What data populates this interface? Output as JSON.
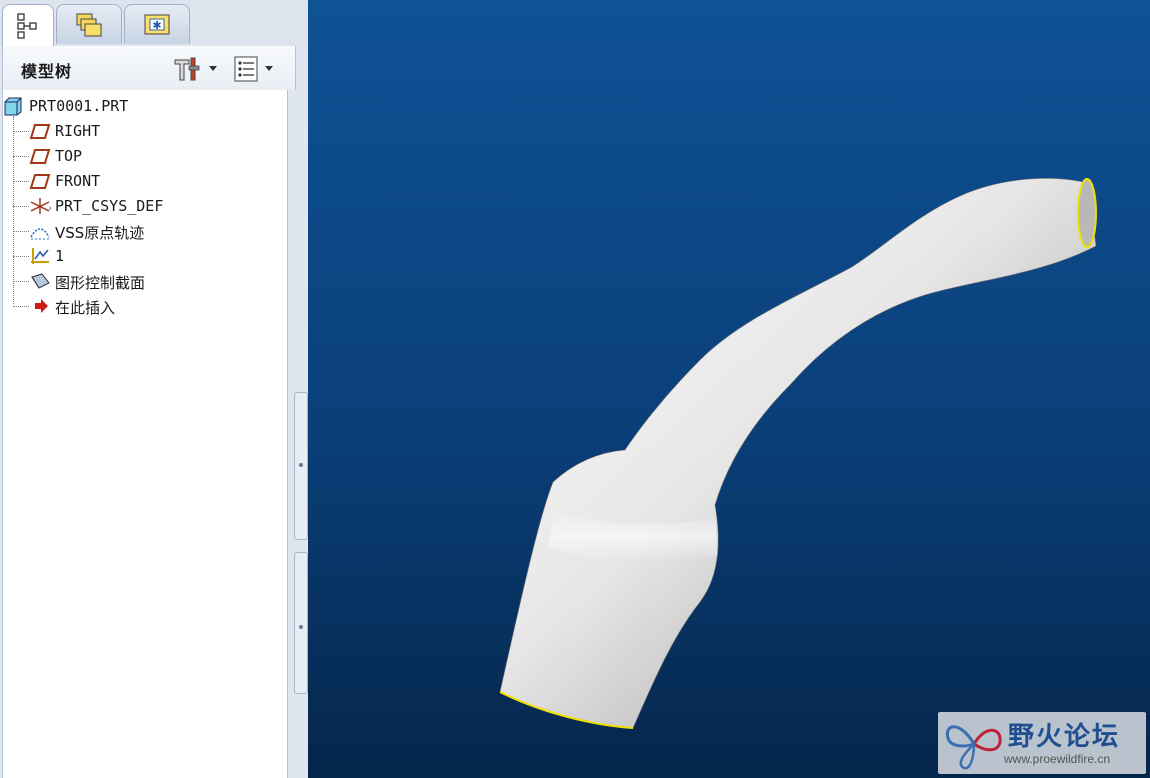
{
  "tabs": [
    {
      "name": "model-tree-tab",
      "icon": "model-tree-icon"
    },
    {
      "name": "folder-browser-tab",
      "icon": "folders-icon"
    },
    {
      "name": "favorites-tab",
      "icon": "favorites-folder-icon"
    }
  ],
  "tree_header": {
    "title": "模型树",
    "settings_icon": "tools-icon",
    "show_icon": "list-icon"
  },
  "tree": {
    "root": "PRT0001.PRT",
    "items": [
      {
        "label": "RIGHT",
        "icon": "datum-plane-icon"
      },
      {
        "label": "TOP",
        "icon": "datum-plane-icon"
      },
      {
        "label": "FRONT",
        "icon": "datum-plane-icon"
      },
      {
        "label": "PRT_CSYS_DEF",
        "icon": "csys-icon"
      },
      {
        "label": "VSS原点轨迹",
        "icon": "sweep-trajectory-icon"
      },
      {
        "label": "1",
        "icon": "graph-icon"
      },
      {
        "label": "图形控制截面",
        "icon": "section-icon"
      },
      {
        "label": "在此插入",
        "icon": "insert-here-arrow-icon"
      }
    ]
  },
  "viewport": {
    "background_top": "#0f5296",
    "background_bottom": "#05264b",
    "edge_color": "#f0e000"
  },
  "watermark": {
    "title": "野火论坛",
    "url": "www.proewildfire.cn"
  }
}
